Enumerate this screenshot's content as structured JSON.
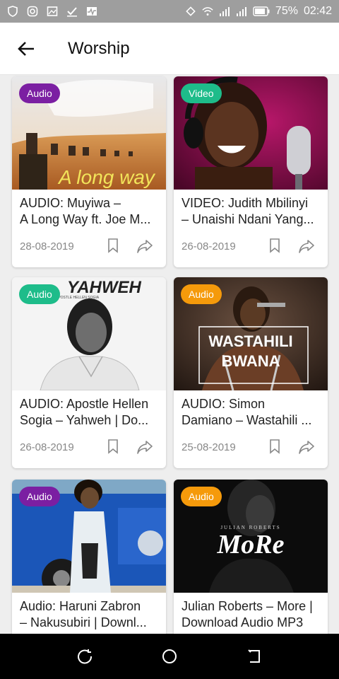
{
  "status_bar": {
    "battery_percent": "75%",
    "time": "02:42",
    "icons": [
      "shield-icon",
      "instagram-icon",
      "image-icon",
      "check-icon",
      "activity-icon",
      "rotate-icon",
      "wifi-icon",
      "signal-icon",
      "battery-icon"
    ]
  },
  "app_bar": {
    "title": "Worship",
    "back_icon": "arrow-left-icon"
  },
  "cards": [
    {
      "badge": "Audio",
      "badge_color": "#7b1fa2",
      "title_line1": "AUDIO: Muyiwa –",
      "title_line2": "A Long Way ft. Joe M...",
      "date": "28-08-2019",
      "thumb_text": "A long way"
    },
    {
      "badge": "Video",
      "badge_color": "#1ebc8a",
      "title_line1": "VIDEO: Judith Mbilinyi",
      "title_line2": "– Unaishi Ndani Yang...",
      "date": "26-08-2019"
    },
    {
      "badge": "Audio",
      "badge_color": "#1ebc8a",
      "title_line1": "AUDIO: Apostle Hellen",
      "title_line2": "Sogia – Yahweh | Do...",
      "date": "26-08-2019",
      "thumb_text": "YAHWEH",
      "thumb_sub": "APOSTLE HELLEN SOGIA"
    },
    {
      "badge": "Audio",
      "badge_color": "#f59a0b",
      "title_line1": "AUDIO: Simon",
      "title_line2": "Damiano – Wastahili ...",
      "date": "25-08-2019",
      "thumb_text": "WASTAHILI",
      "thumb_text2": "BWANA"
    },
    {
      "badge": "Audio",
      "badge_color": "#7b1fa2",
      "title_line1": "Audio: Haruni Zabron",
      "title_line2": "– Nakusubiri | Downl...",
      "date": ""
    },
    {
      "badge": "Audio",
      "badge_color": "#f59a0b",
      "title_line1": "Julian Roberts – More |",
      "title_line2": "Download Audio MP3",
      "date": "",
      "thumb_text": "MoRe",
      "thumb_sub": "JULIAN ROBERTS"
    }
  ],
  "nav_bar": {
    "icons": [
      "recents-icon",
      "home-icon",
      "back-icon"
    ]
  }
}
